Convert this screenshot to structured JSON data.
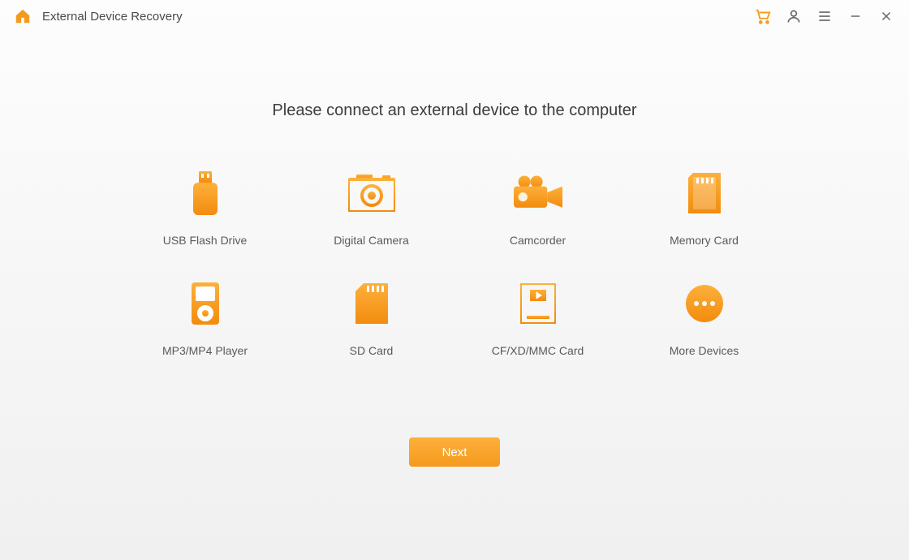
{
  "titlebar": {
    "app_title": "External Device Recovery"
  },
  "main": {
    "instruction": "Please connect  an external device to the computer"
  },
  "devices": [
    {
      "label": "USB Flash Drive"
    },
    {
      "label": "Digital Camera"
    },
    {
      "label": "Camcorder"
    },
    {
      "label": "Memory Card"
    },
    {
      "label": "MP3/MP4 Player"
    },
    {
      "label": "SD Card"
    },
    {
      "label": "CF/XD/MMC Card"
    },
    {
      "label": "More Devices"
    }
  ],
  "buttons": {
    "next": "Next"
  },
  "colors": {
    "accent": "#f59a1e",
    "accent_light": "#fdb03b",
    "text_primary": "#3c3c3c",
    "text_secondary": "#5a5a5a"
  }
}
